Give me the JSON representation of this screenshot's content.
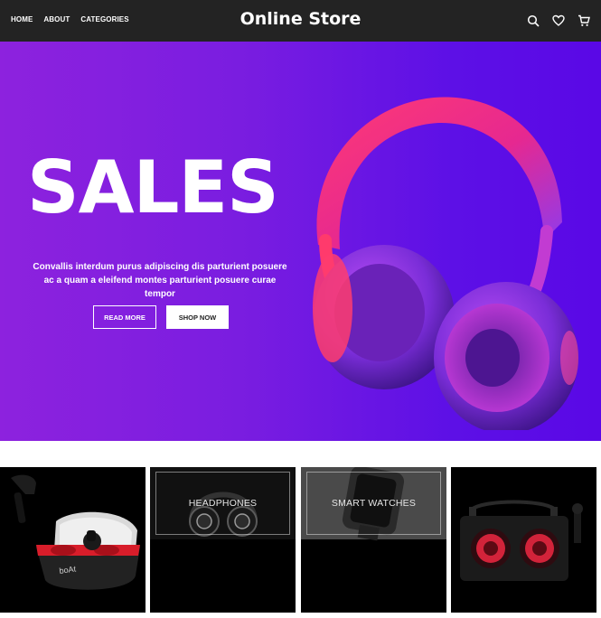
{
  "header": {
    "nav": [
      {
        "label": "HOME"
      },
      {
        "label": "ABOUT"
      },
      {
        "label": "CATEGORIES"
      }
    ],
    "brand": "Online Store",
    "icons": [
      "search-icon",
      "heart-icon",
      "cart-icon"
    ]
  },
  "hero": {
    "title": "SALES",
    "text": "Convallis interdum purus adipiscing dis parturient posuere ac a quam a eleifend montes parturient posuere curae tempor",
    "read_more": "READ MORE",
    "shop_now": "SHOP NOW",
    "colors": {
      "gradient_start": "#8d22de",
      "gradient_end": "#5a08e6",
      "headphone_accent": "#ff2d7a"
    }
  },
  "tiles": [
    {
      "name": "earbuds",
      "label": ""
    },
    {
      "name": "headphones",
      "label": "HEADPHONES"
    },
    {
      "name": "smart-watches",
      "label": "SMART WATCHES"
    },
    {
      "name": "speaker",
      "label": ""
    }
  ]
}
